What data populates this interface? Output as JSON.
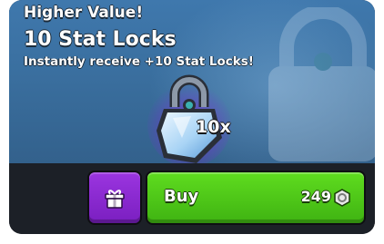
{
  "offer": {
    "badge": "Higher Value!",
    "title": "10 Stat Locks",
    "description": "Instantly receive +10 Stat Locks!",
    "quantity": "10x",
    "item_icon": "lock-icon"
  },
  "actions": {
    "gift_icon": "gift-icon",
    "buy_label": "Buy",
    "price": "249",
    "currency_icon": "coin-icon"
  },
  "colors": {
    "banner": "#3f78ad",
    "buy_green": "#4fc817",
    "gift_purple": "#8a2bd0",
    "bar_dark": "#1c2027"
  }
}
